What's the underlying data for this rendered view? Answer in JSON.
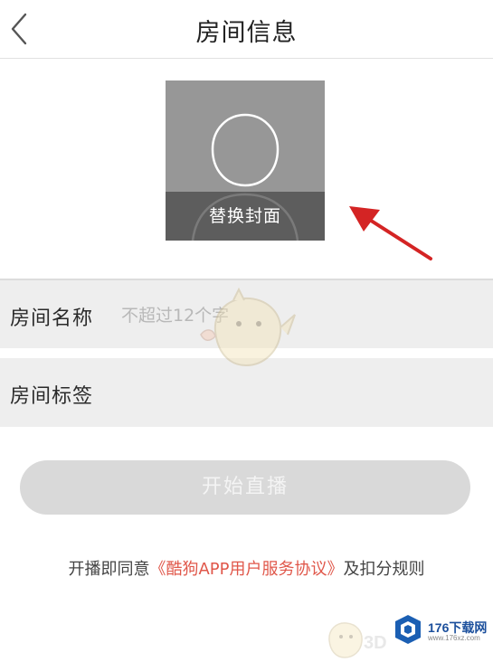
{
  "header": {
    "title": "房间信息",
    "back_icon": "chevron-left-icon"
  },
  "cover": {
    "overlay_label": "替换封面",
    "placeholder_icon": "user-silhouette-icon"
  },
  "form": {
    "room_name_label": "房间名称",
    "room_name_placeholder": "不超过12个字",
    "room_tag_label": "房间标签"
  },
  "actions": {
    "start_label": "开始直播"
  },
  "agreement": {
    "prefix": "开播即同意",
    "link_label": "《酷狗APP用户服务协议》",
    "suffix": "及扣分规则"
  },
  "watermark": {
    "text": "176下载网",
    "sub": "www.176xz.com",
    "mark": "3D"
  },
  "colors": {
    "accent_link": "#e0574a",
    "arrow": "#d42424",
    "button_disabled": "#d9d9d9"
  }
}
